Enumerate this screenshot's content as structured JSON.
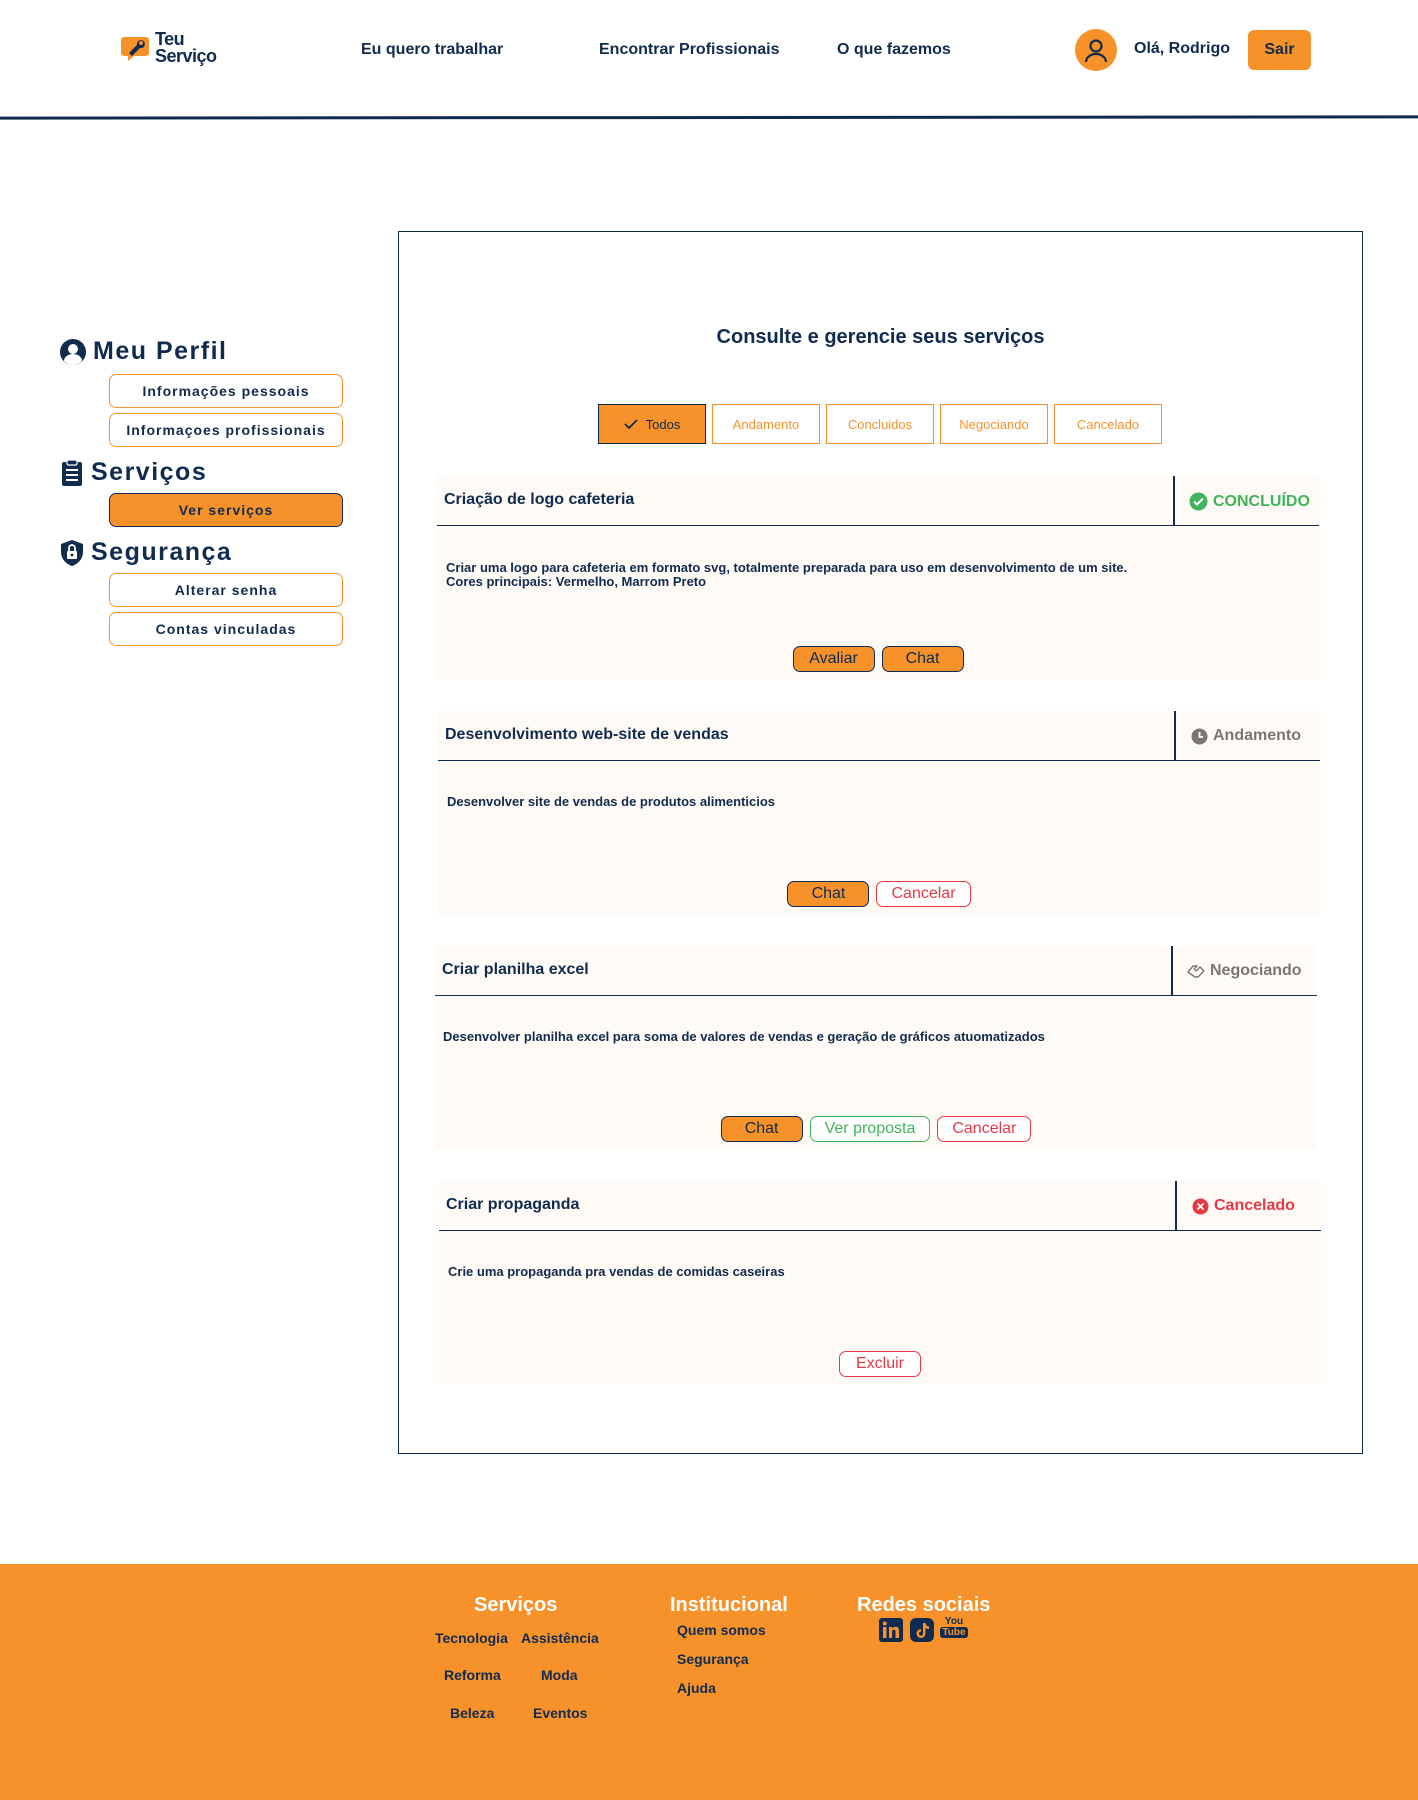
{
  "header": {
    "logo_line1": "Teu",
    "logo_line2": "Serviço",
    "nav": [
      "Eu quero trabalhar",
      "Encontrar Profissionais",
      "O que fazemos"
    ],
    "greeting": "Olá, Rodrigo",
    "logout_label": "Sair"
  },
  "sidebar": {
    "profile": {
      "title": "Meu Perfil",
      "items": [
        "Informações pessoais",
        "Informaçoes profissionais"
      ]
    },
    "services": {
      "title": "Serviços",
      "items": [
        "Ver serviços"
      ],
      "active": "Ver serviços"
    },
    "security": {
      "title": "Segurança",
      "items": [
        "Alterar senha",
        "Contas vinculadas"
      ]
    }
  },
  "main": {
    "title": "Consulte e gerencie seus serviços",
    "filters": [
      "Todos",
      "Andamento",
      "Concluidos",
      "Negociando",
      "Cancelado"
    ],
    "active_filter": "Todos",
    "cards": [
      {
        "title": "Criação de logo cafeteria",
        "status": "CONCLUÍDO",
        "status_icon": "check-circle-icon",
        "desc_lines": [
          "Criar uma logo para cafeteria em formato svg, totalmente preparada para uso em desenvolvimento de um site.",
          "Cores principais: Vermelho, Marrom Preto"
        ],
        "actions": [
          "Avaliar",
          "Chat"
        ]
      },
      {
        "title": "Desenvolvimento web-site de vendas",
        "status": "Andamento",
        "status_icon": "clock-icon",
        "desc_lines": [
          "Desenvolver site de vendas de produtos alimenticios"
        ],
        "actions": [
          "Chat",
          "Cancelar"
        ]
      },
      {
        "title": "Criar planilha excel",
        "status": "Negociando",
        "status_icon": "handshake-icon",
        "desc_lines": [
          "Desenvolver planilha excel para soma de valores de vendas e geração de gráficos atuomatizados"
        ],
        "actions": [
          "Chat",
          "Ver proposta",
          "Cancelar"
        ]
      },
      {
        "title": "Criar propaganda",
        "status": "Cancelado",
        "status_icon": "x-circle-icon",
        "desc_lines": [
          "Crie uma propaganda pra vendas de comidas caseiras"
        ],
        "actions": [
          "Excluir"
        ]
      }
    ]
  },
  "footer": {
    "services": {
      "title": "Serviços",
      "links": [
        "Tecnologia",
        "Assistência",
        "Reforma",
        "Moda",
        "Beleza",
        "Eventos"
      ]
    },
    "institutional": {
      "title": "Institucional",
      "links": [
        "Quem somos",
        "Segurança",
        "Ajuda"
      ]
    },
    "social": {
      "title": "Redes sociais",
      "networks": [
        "linkedin-icon",
        "tiktok-icon",
        "youtube-icon"
      ],
      "youtube_text": [
        "You",
        "Tube"
      ]
    }
  },
  "colors": {
    "brand_orange": "#f7922a",
    "navy": "#0f2b4f",
    "success": "#3fb45b",
    "danger": "#e63946",
    "neutral": "#777777"
  }
}
